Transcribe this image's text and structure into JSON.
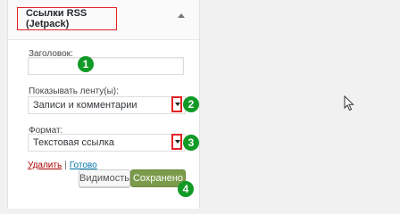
{
  "widget": {
    "title": "Ссылки RSS (Jetpack)",
    "fields": {
      "title_label": "Заголовок:",
      "title_value": "",
      "feed_label": "Показывать ленту(ы):",
      "feed_value": "Записи и комментарии",
      "format_label": "Формат:",
      "format_value": "Текстовая ссылка"
    },
    "actions": {
      "delete_label": "Удалить",
      "separator": "|",
      "done_label": "Готово",
      "visibility_label": "Видимость",
      "save_label": "Сохранено"
    }
  },
  "annotations": [
    "1",
    "2",
    "3",
    "4"
  ],
  "colors": {
    "highlight": "#e32227",
    "badge": "#119a26",
    "primary_button": "#7b9a4a"
  },
  "icons": {
    "collapse": "chevron-up-icon",
    "dropdown": "caret-down-icon",
    "cursor": "mouse-pointer-icon"
  }
}
